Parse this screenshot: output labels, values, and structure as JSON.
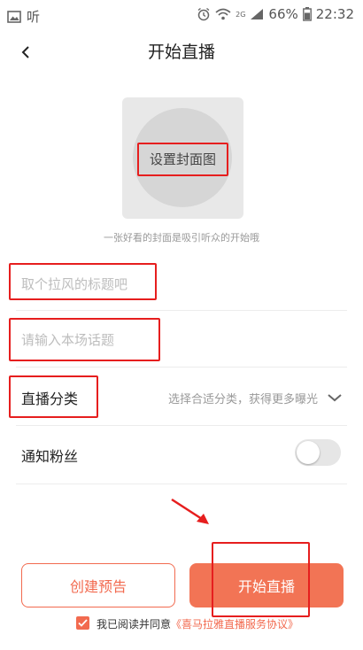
{
  "status_bar": {
    "app_label": "听",
    "battery": "66%",
    "time": "22:32",
    "network": "2G"
  },
  "header": {
    "title": "开始直播"
  },
  "cover": {
    "label": "设置封面图",
    "hint": "一张好看的封面是吸引听众的开始哦"
  },
  "form": {
    "title_placeholder": "取个拉风的标题吧",
    "topic_placeholder": "请输入本场话题",
    "category_label": "直播分类",
    "category_hint": "选择合适分类，获得更多曝光",
    "notify_label": "通知粉丝",
    "notify_on": false
  },
  "actions": {
    "create_preview": "创建预告",
    "start_live": "开始直播"
  },
  "agreement": {
    "checked": true,
    "prefix": "我已阅读并同意",
    "link": "《喜马拉雅直播服务协议》"
  },
  "colors": {
    "accent": "#f26a4f",
    "annotation": "#e61e1e"
  }
}
